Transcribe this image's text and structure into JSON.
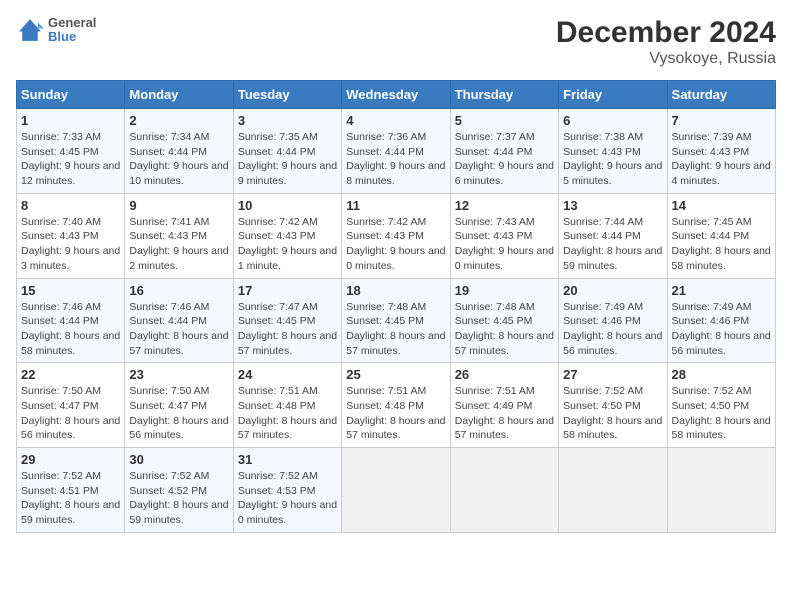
{
  "logo": {
    "line1": "General",
    "line2": "Blue"
  },
  "title": "December 2024",
  "subtitle": "Vysokoye, Russia",
  "weekdays": [
    "Sunday",
    "Monday",
    "Tuesday",
    "Wednesday",
    "Thursday",
    "Friday",
    "Saturday"
  ],
  "weeks": [
    [
      {
        "day": 1,
        "info": "Sunrise: 7:33 AM\nSunset: 4:45 PM\nDaylight: 9 hours and 12 minutes."
      },
      {
        "day": 2,
        "info": "Sunrise: 7:34 AM\nSunset: 4:44 PM\nDaylight: 9 hours and 10 minutes."
      },
      {
        "day": 3,
        "info": "Sunrise: 7:35 AM\nSunset: 4:44 PM\nDaylight: 9 hours and 9 minutes."
      },
      {
        "day": 4,
        "info": "Sunrise: 7:36 AM\nSunset: 4:44 PM\nDaylight: 9 hours and 8 minutes."
      },
      {
        "day": 5,
        "info": "Sunrise: 7:37 AM\nSunset: 4:44 PM\nDaylight: 9 hours and 6 minutes."
      },
      {
        "day": 6,
        "info": "Sunrise: 7:38 AM\nSunset: 4:43 PM\nDaylight: 9 hours and 5 minutes."
      },
      {
        "day": 7,
        "info": "Sunrise: 7:39 AM\nSunset: 4:43 PM\nDaylight: 9 hours and 4 minutes."
      }
    ],
    [
      {
        "day": 8,
        "info": "Sunrise: 7:40 AM\nSunset: 4:43 PM\nDaylight: 9 hours and 3 minutes."
      },
      {
        "day": 9,
        "info": "Sunrise: 7:41 AM\nSunset: 4:43 PM\nDaylight: 9 hours and 2 minutes."
      },
      {
        "day": 10,
        "info": "Sunrise: 7:42 AM\nSunset: 4:43 PM\nDaylight: 9 hours and 1 minute."
      },
      {
        "day": 11,
        "info": "Sunrise: 7:42 AM\nSunset: 4:43 PM\nDaylight: 9 hours and 0 minutes."
      },
      {
        "day": 12,
        "info": "Sunrise: 7:43 AM\nSunset: 4:43 PM\nDaylight: 9 hours and 0 minutes."
      },
      {
        "day": 13,
        "info": "Sunrise: 7:44 AM\nSunset: 4:44 PM\nDaylight: 8 hours and 59 minutes."
      },
      {
        "day": 14,
        "info": "Sunrise: 7:45 AM\nSunset: 4:44 PM\nDaylight: 8 hours and 58 minutes."
      }
    ],
    [
      {
        "day": 15,
        "info": "Sunrise: 7:46 AM\nSunset: 4:44 PM\nDaylight: 8 hours and 58 minutes."
      },
      {
        "day": 16,
        "info": "Sunrise: 7:46 AM\nSunset: 4:44 PM\nDaylight: 8 hours and 57 minutes."
      },
      {
        "day": 17,
        "info": "Sunrise: 7:47 AM\nSunset: 4:45 PM\nDaylight: 8 hours and 57 minutes."
      },
      {
        "day": 18,
        "info": "Sunrise: 7:48 AM\nSunset: 4:45 PM\nDaylight: 8 hours and 57 minutes."
      },
      {
        "day": 19,
        "info": "Sunrise: 7:48 AM\nSunset: 4:45 PM\nDaylight: 8 hours and 57 minutes."
      },
      {
        "day": 20,
        "info": "Sunrise: 7:49 AM\nSunset: 4:46 PM\nDaylight: 8 hours and 56 minutes."
      },
      {
        "day": 21,
        "info": "Sunrise: 7:49 AM\nSunset: 4:46 PM\nDaylight: 8 hours and 56 minutes."
      }
    ],
    [
      {
        "day": 22,
        "info": "Sunrise: 7:50 AM\nSunset: 4:47 PM\nDaylight: 8 hours and 56 minutes."
      },
      {
        "day": 23,
        "info": "Sunrise: 7:50 AM\nSunset: 4:47 PM\nDaylight: 8 hours and 56 minutes."
      },
      {
        "day": 24,
        "info": "Sunrise: 7:51 AM\nSunset: 4:48 PM\nDaylight: 8 hours and 57 minutes."
      },
      {
        "day": 25,
        "info": "Sunrise: 7:51 AM\nSunset: 4:48 PM\nDaylight: 8 hours and 57 minutes."
      },
      {
        "day": 26,
        "info": "Sunrise: 7:51 AM\nSunset: 4:49 PM\nDaylight: 8 hours and 57 minutes."
      },
      {
        "day": 27,
        "info": "Sunrise: 7:52 AM\nSunset: 4:50 PM\nDaylight: 8 hours and 58 minutes."
      },
      {
        "day": 28,
        "info": "Sunrise: 7:52 AM\nSunset: 4:50 PM\nDaylight: 8 hours and 58 minutes."
      }
    ],
    [
      {
        "day": 29,
        "info": "Sunrise: 7:52 AM\nSunset: 4:51 PM\nDaylight: 8 hours and 59 minutes."
      },
      {
        "day": 30,
        "info": "Sunrise: 7:52 AM\nSunset: 4:52 PM\nDaylight: 8 hours and 59 minutes."
      },
      {
        "day": 31,
        "info": "Sunrise: 7:52 AM\nSunset: 4:53 PM\nDaylight: 9 hours and 0 minutes."
      },
      null,
      null,
      null,
      null
    ]
  ]
}
